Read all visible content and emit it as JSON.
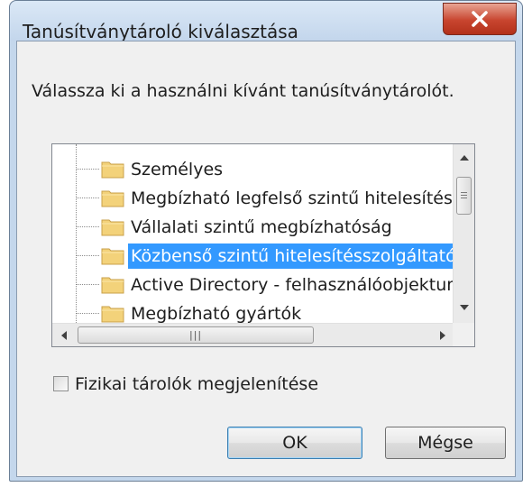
{
  "window": {
    "title": "Tanúsítványtároló kiválasztása"
  },
  "dialog": {
    "instruction": "Válassza ki a használni kívánt tanúsítványtárolót.",
    "stores": [
      {
        "label": "Személyes",
        "selected": false
      },
      {
        "label": "Megbízható legfelső szintű hitelesítésszol",
        "selected": false
      },
      {
        "label": "Vállalati szintű megbízhatóság",
        "selected": false
      },
      {
        "label": "Közbenső szintű hitelesítésszolgáltatók",
        "selected": true
      },
      {
        "label": "Active Directory - felhasználóobjektum",
        "selected": false
      },
      {
        "label": "Megbízható gyártók",
        "selected": false
      }
    ],
    "show_physical_label": "Fizikai tárolók megjelenítése",
    "show_physical_checked": false,
    "ok_label": "OK",
    "cancel_label": "Mégse"
  },
  "icons": {
    "close": "close-icon",
    "folder": "folder-icon",
    "scroll_up": "arrow-up-icon",
    "scroll_down": "arrow-down-icon",
    "scroll_left": "arrow-left-icon",
    "scroll_right": "arrow-right-icon"
  },
  "colors": {
    "selection": "#3399ff",
    "close_button": "#c8452f",
    "folder": "#f3d27a"
  }
}
